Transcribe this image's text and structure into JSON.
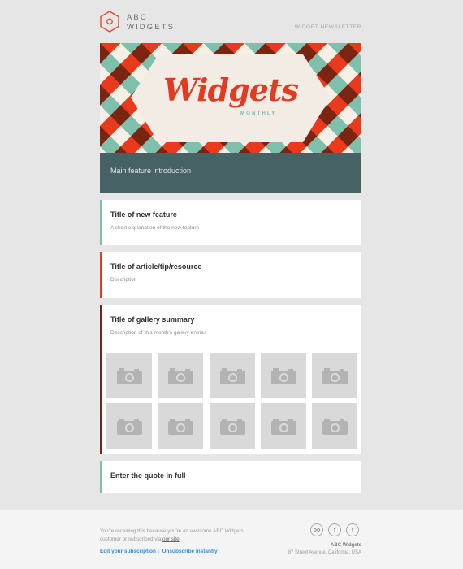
{
  "brand": {
    "line1": "ABC",
    "line2": "WIDGETS",
    "newsletter_label": "WIDGET NEWSLETTER"
  },
  "hero": {
    "title": "Widgets",
    "subtitle": "MONTHLY",
    "intro": "Main feature introduction"
  },
  "cards": {
    "feature": {
      "title": "Title of new feature",
      "desc": "A short explanation of the new feature",
      "accent": "#7dbfa9"
    },
    "article": {
      "title": "Title of article/tip/resource",
      "desc": "Description",
      "accent": "#e63a1f"
    },
    "gallery": {
      "title": "Title of gallery summary",
      "desc": "Description of this month's gallery entries",
      "accent": "#7b2311",
      "thumb_icon": "camera-icon"
    },
    "quote": {
      "title": "Enter the quote in full",
      "accent": "#7dbfa9"
    }
  },
  "footer": {
    "text_line1": "You're receiving this because you're an awesome ABC Widgets",
    "text_line2": "customer or subscribed via",
    "site_link": "our site",
    "edit_link": "Edit your subscription",
    "unsubscribe_link": "Unsubscribe instantly",
    "social_icons": [
      "flickr-icon",
      "facebook-icon",
      "twitter-icon"
    ],
    "company_name": "ABC Widgets",
    "address": "87 Street Avenue, California, USA"
  }
}
